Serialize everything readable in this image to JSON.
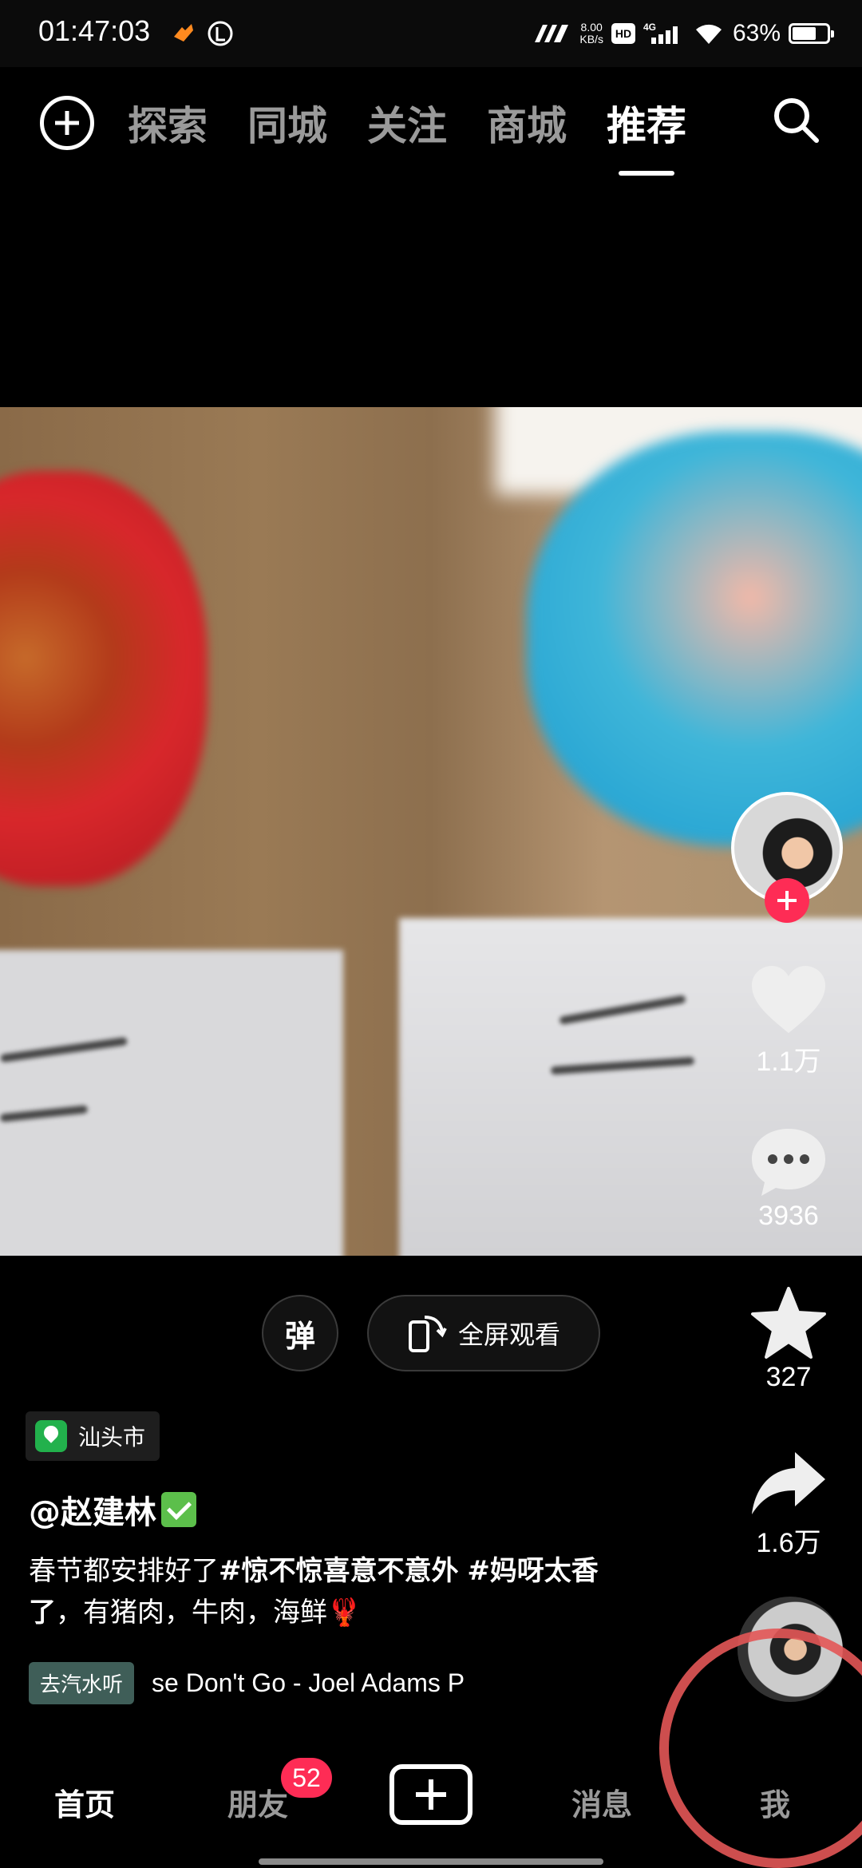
{
  "status_bar": {
    "time": "01:47:03",
    "net_speed_value": "8.00",
    "net_speed_unit": "KB/s",
    "hd": "HD",
    "network": "4G",
    "battery": "63%",
    "battery_level": 0.63
  },
  "top_nav": {
    "tabs": [
      {
        "label": "探索",
        "active": false
      },
      {
        "label": "同城",
        "active": false
      },
      {
        "label": "关注",
        "active": false
      },
      {
        "label": "商城",
        "active": false
      },
      {
        "label": "推荐",
        "active": true
      }
    ]
  },
  "actions": {
    "likes": "1.1万",
    "comments": "3936",
    "favorites": "327",
    "shares": "1.6万"
  },
  "controls": {
    "danmu": "弹",
    "fullscreen": "全屏观看"
  },
  "post": {
    "location": "汕头市",
    "username": "@赵建林",
    "caption_prefix": "春节都安排好了",
    "hashtag1": "#惊不惊喜意不意外",
    "hashtag2": "#妈呀太香了",
    "caption_suffix": "，有猪肉，牛肉，海鲜🦞",
    "music_tag": "去汽水听",
    "music_name": "se Don't Go - Joel Adams    P"
  },
  "bottom_nav": {
    "home": "首页",
    "friends": "朋友",
    "friends_badge": "52",
    "messages": "消息",
    "me": "我"
  },
  "colors": {
    "accent": "#fe2c55",
    "highlight": "#e35656"
  }
}
